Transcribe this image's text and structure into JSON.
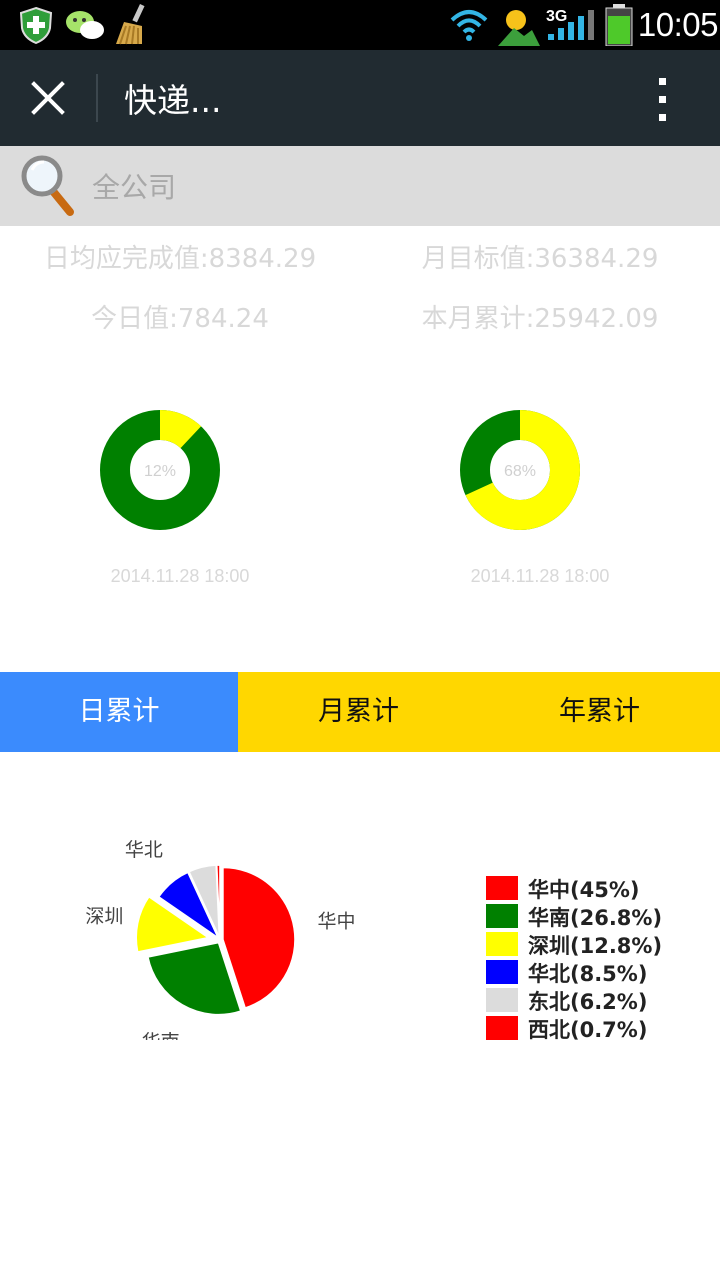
{
  "status_bar": {
    "time": "10:05",
    "network": "3G",
    "icons": [
      "shield-plus-icon",
      "wechat-icon",
      "broom-icon",
      "wifi-icon",
      "weather-icon",
      "signal-icon",
      "battery-icon"
    ]
  },
  "titlebar": {
    "title": "快递...",
    "icons": [
      "close-icon",
      "more-vert-icon"
    ]
  },
  "search": {
    "placeholder": "全公司",
    "icon": "magnifier-icon"
  },
  "stats": {
    "daily_target": "日均应完成值:8384.29",
    "monthly_target": "月目标值:36384.29",
    "today_value": "今日值:784.24",
    "month_total": "本月累计:25942.09"
  },
  "donuts": [
    {
      "percent": 12,
      "label": "12%",
      "time": "2014.11.28 18:00"
    },
    {
      "percent": 68,
      "label": "68%",
      "time": "2014.11.28 18:00"
    }
  ],
  "tabs": [
    {
      "label": "日累计",
      "active": true
    },
    {
      "label": "月累计",
      "active": false
    },
    {
      "label": "年累计",
      "active": false
    }
  ],
  "colors": {
    "donut_done": "#ffff00",
    "donut_rest": "#008000",
    "tab_active": "#3b8bfd",
    "tab_bar": "#ffd700"
  },
  "chart_data": {
    "type": "pie",
    "slices": [
      {
        "name": "华中",
        "value": 45,
        "color": "#ff0000"
      },
      {
        "name": "华南",
        "value": 26.8,
        "color": "#008000"
      },
      {
        "name": "深圳",
        "value": 12.8,
        "color": "#ffff00"
      },
      {
        "name": "华北",
        "value": 8.5,
        "color": "#0000ff"
      },
      {
        "name": "东北",
        "value": 6.2,
        "color": "#dcdcdc"
      },
      {
        "name": "西北",
        "value": 0.7,
        "color": "#ff0000"
      }
    ],
    "legend": [
      "华中(45%)",
      "华南(26.8%)",
      "深圳(12.8%)",
      "华北(8.5%)",
      "东北(6.2%)",
      "西北(0.7%)"
    ],
    "legend_position": "right"
  }
}
